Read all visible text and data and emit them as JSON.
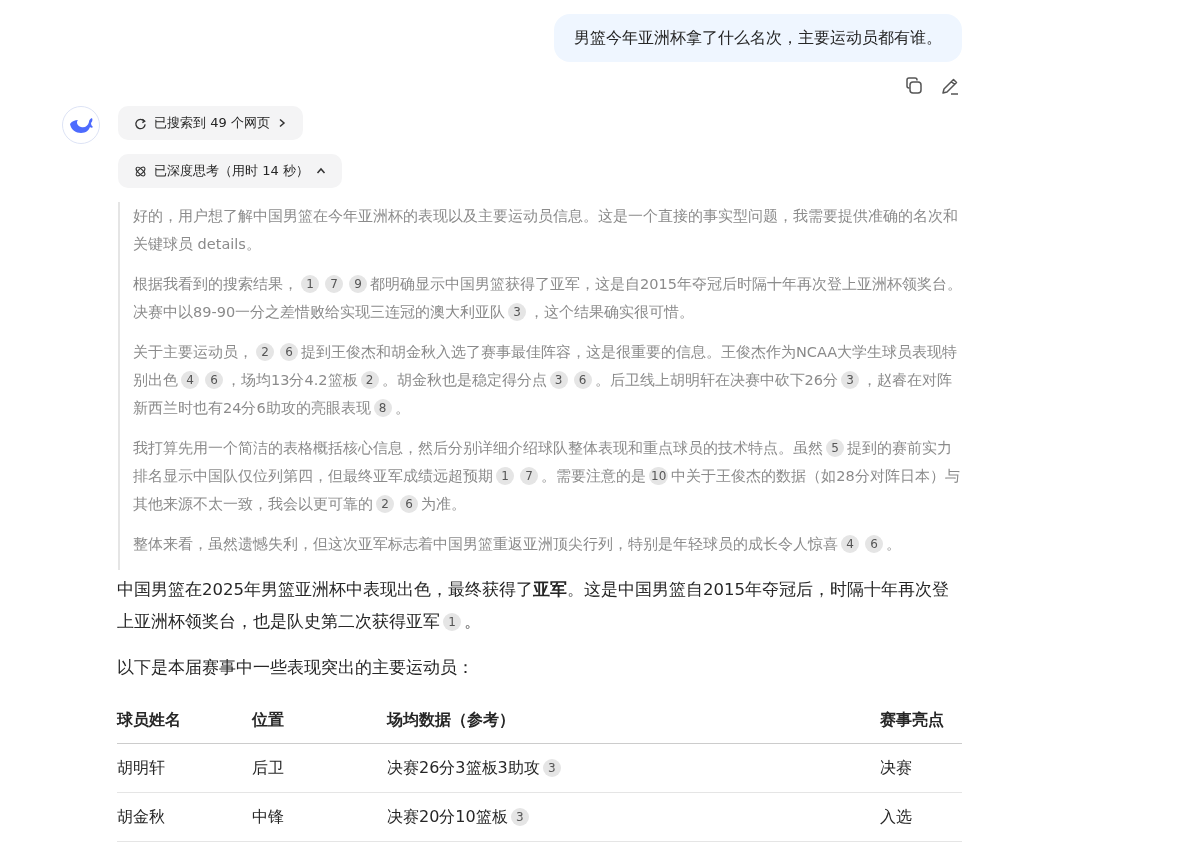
{
  "user_message": {
    "text": "男篮今年亚洲杯拿了什么名次，主要运动员都有谁。"
  },
  "search_chip": {
    "label": "已搜索到 49 个网页"
  },
  "thinking_chip": {
    "label": "已深度思考（用时 14 秒）",
    "expanded": true
  },
  "thinking": [
    [
      {
        "text": "好的，用户想了解中国男篮在今年亚洲杯的表现以及主要运动员信息。这是一个直接的事实型问题，我需要提供准确的名次和关键球员 details。"
      }
    ],
    [
      {
        "text": "根据我看到的搜索结果，"
      },
      {
        "cite": "1"
      },
      {
        "cite": "7"
      },
      {
        "cite": "9"
      },
      {
        "text": "都明确显示中国男篮获得了亚军，这是自2015年夺冠后时隔十年再次登上亚洲杯领奖台。决赛中以89-90一分之差惜败给实现三连冠的澳大利亚队"
      },
      {
        "cite": "3"
      },
      {
        "text": "，这个结果确实很可惜。"
      }
    ],
    [
      {
        "text": "关于主要运动员，"
      },
      {
        "cite": "2"
      },
      {
        "cite": "6"
      },
      {
        "text": "提到王俊杰和胡金秋入选了赛事最佳阵容，这是很重要的信息。王俊杰作为NCAA大学生球员表现特别出色"
      },
      {
        "cite": "4"
      },
      {
        "cite": "6"
      },
      {
        "text": "，场均13分4.2篮板"
      },
      {
        "cite": "2"
      },
      {
        "text": "。胡金秋也是稳定得分点"
      },
      {
        "cite": "3"
      },
      {
        "cite": "6"
      },
      {
        "text": "。后卫线上胡明轩在决赛中砍下26分"
      },
      {
        "cite": "3"
      },
      {
        "text": "，赵睿在对阵新西兰时也有24分6助攻的亮眼表现"
      },
      {
        "cite": "8"
      },
      {
        "text": "。"
      }
    ],
    [
      {
        "text": "我打算先用一个简洁的表格概括核心信息，然后分别详细介绍球队整体表现和重点球员的技术特点。虽然"
      },
      {
        "cite": "5"
      },
      {
        "text": "提到的赛前实力排名显示中国队仅位列第四，但最终亚军成绩远超预期"
      },
      {
        "cite": "1"
      },
      {
        "cite": "7"
      },
      {
        "text": "。需要注意的是"
      },
      {
        "cite": "10"
      },
      {
        "text": "中关于王俊杰的数据（如28分对阵日本）与其他来源不太一致，我会以更可靠的"
      },
      {
        "cite": "2"
      },
      {
        "cite": "6"
      },
      {
        "text": "为准。"
      }
    ],
    [
      {
        "text": "整体来看，虽然遗憾失利，但这次亚军标志着中国男篮重返亚洲顶尖行列，特别是年轻球员的成长令人惊喜"
      },
      {
        "cite": "4"
      },
      {
        "cite": "6"
      },
      {
        "text": "。"
      }
    ]
  ],
  "answer": [
    [
      {
        "text": "中国男篮在2025年男篮亚洲杯中表现出色，最终获得了**亚军**。这是中国男篮自2015年夺冠后，时隔十年再次登上亚洲杯领奖台，也是队史第二次获得亚军"
      },
      {
        "cite": "1"
      },
      {
        "text": "。"
      }
    ],
    [
      {
        "text": "以下是本届赛事中一些表现突出的主要运动员："
      }
    ]
  ],
  "table": {
    "columns": [
      "球员姓名",
      "位置",
      "场均数据（参考）",
      "赛事亮点"
    ],
    "rows": [
      {
        "cells": [
          {
            "text": "胡明轩"
          },
          {
            "text": "后卫"
          },
          {
            "text": "决赛26分3篮板3助攻",
            "cite": "3"
          },
          {
            "text": "决赛"
          }
        ]
      },
      {
        "cells": [
          {
            "text": "胡金秋"
          },
          {
            "text": "中锋"
          },
          {
            "text": "决赛20分10篮板",
            "cite": "3"
          },
          {
            "text": "入选"
          }
        ]
      }
    ]
  }
}
